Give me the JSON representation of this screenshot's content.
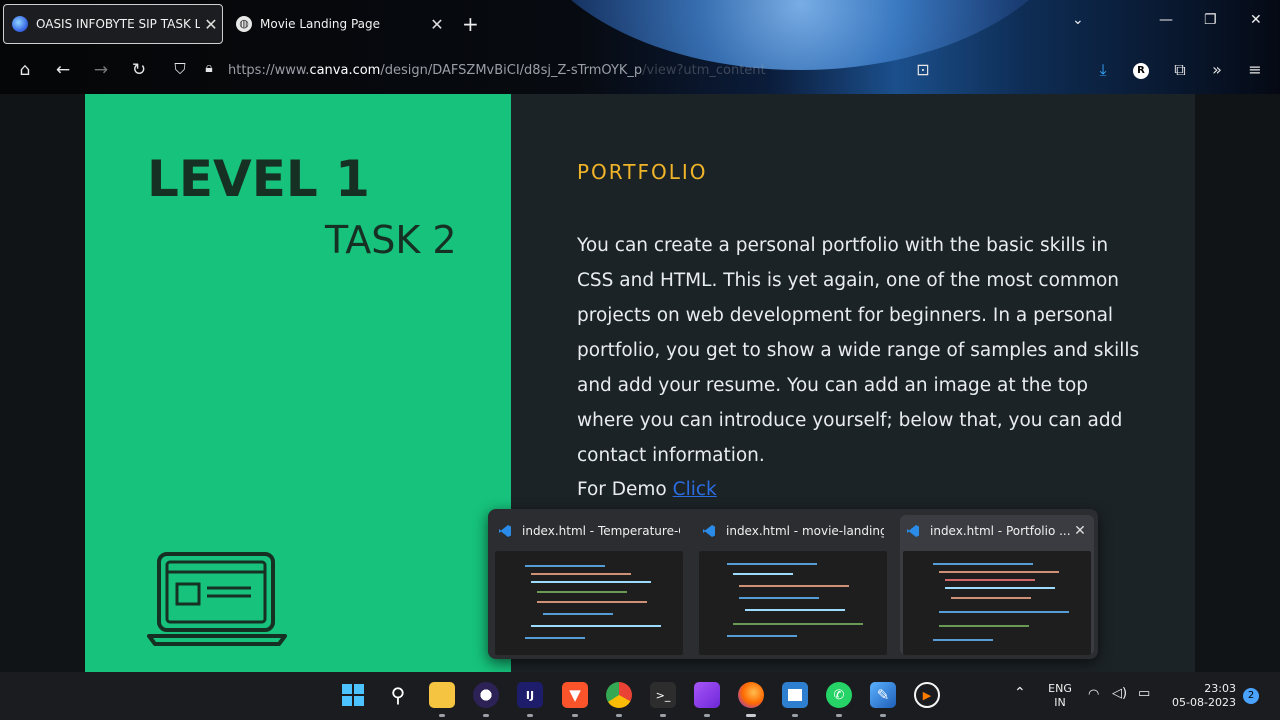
{
  "browser": {
    "tabs": [
      {
        "title": "OASIS INFOBYTE SIP TASK LIST",
        "active": true
      },
      {
        "title": "Movie Landing Page",
        "active": false
      }
    ],
    "url_prefix": "https://www.",
    "url_domain": "canva.com",
    "url_path": "/design/DAFSZMvBiCI/d8sj_Z-sTrmOYK_p",
    "url_faded": "/view?utm_content"
  },
  "slide": {
    "level": "LEVEL 1",
    "task": "TASK 2",
    "heading": "PORTFOLIO",
    "description": "You can create a personal portfolio with the basic skills in CSS and HTML. This is yet again, one of the most common projects on web development for beginners. In a personal portfolio, you get to show a wide range of samples and skills and add your resume. You can add an image at the top where you can introduce yourself; below that, you can add contact information.",
    "demo_label": "For Demo",
    "demo_link": "Click",
    "colors": {
      "green": "#16c27c",
      "heading": "#f0b429",
      "link": "#2b6de0"
    }
  },
  "preview": {
    "windows": [
      {
        "title": "index.html - Temperature-Co..."
      },
      {
        "title": "index.html - movie-landing-p..."
      },
      {
        "title": "index.html - Portfolio ..."
      }
    ]
  },
  "taskbar": {
    "lang_top": "ENG",
    "lang_bottom": "IN",
    "time": "23:03",
    "date": "05-08-2023",
    "notifications": "2",
    "apps": [
      "start",
      "search",
      "file-explorer",
      "eclipse",
      "intellij",
      "brave",
      "chrome",
      "terminal",
      "video-editor",
      "firefox",
      "notepad",
      "whatsapp",
      "paint",
      "media-player"
    ]
  }
}
